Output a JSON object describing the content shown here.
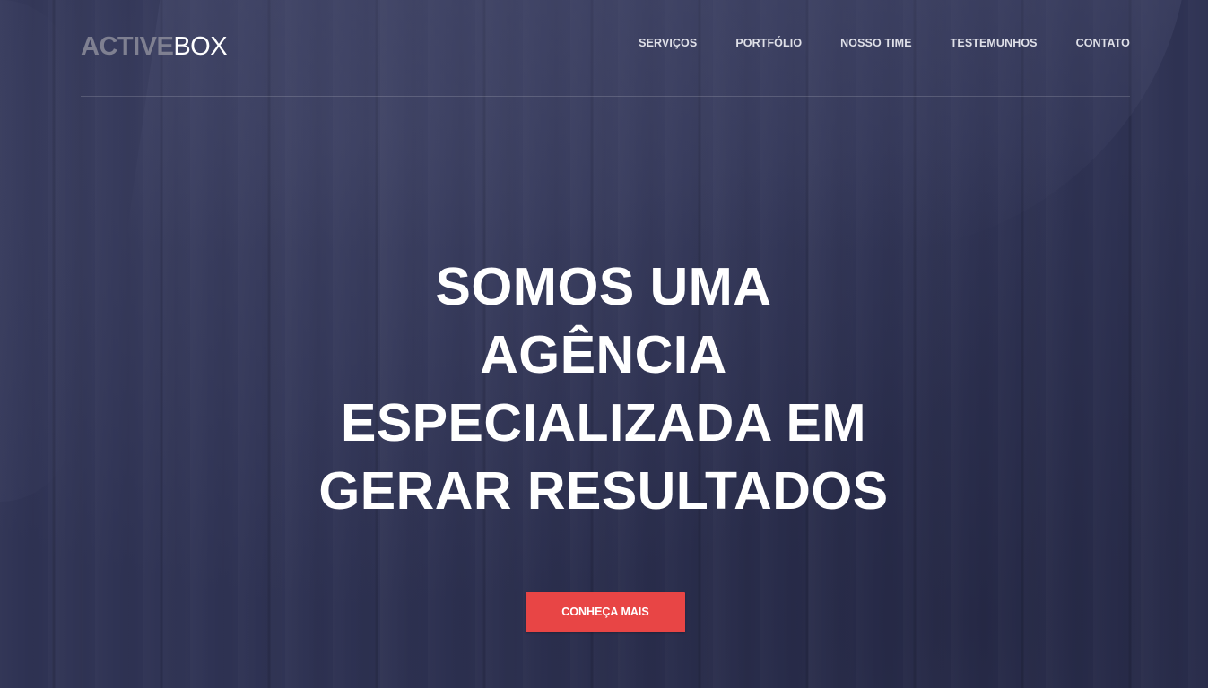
{
  "brand": {
    "logo_bold": "ACTIVE",
    "logo_light": "BOX"
  },
  "nav": {
    "items": [
      {
        "label": "SERVIÇOS"
      },
      {
        "label": "PORTFÓLIO"
      },
      {
        "label": "NOSSO TIME"
      },
      {
        "label": "TESTEMUNHOS"
      },
      {
        "label": "CONTATO"
      }
    ]
  },
  "hero": {
    "headline_lines": [
      "SOMOS UMA",
      "AGÊNCIA",
      "ESPECIALIZADA EM",
      "GERAR RESULTADOS"
    ],
    "cta_label": "CONHEÇA MAIS"
  },
  "colors": {
    "background": "#2f3354",
    "accent": "#e84545",
    "logo_gray": "#7f8091",
    "text": "#ffffff"
  }
}
